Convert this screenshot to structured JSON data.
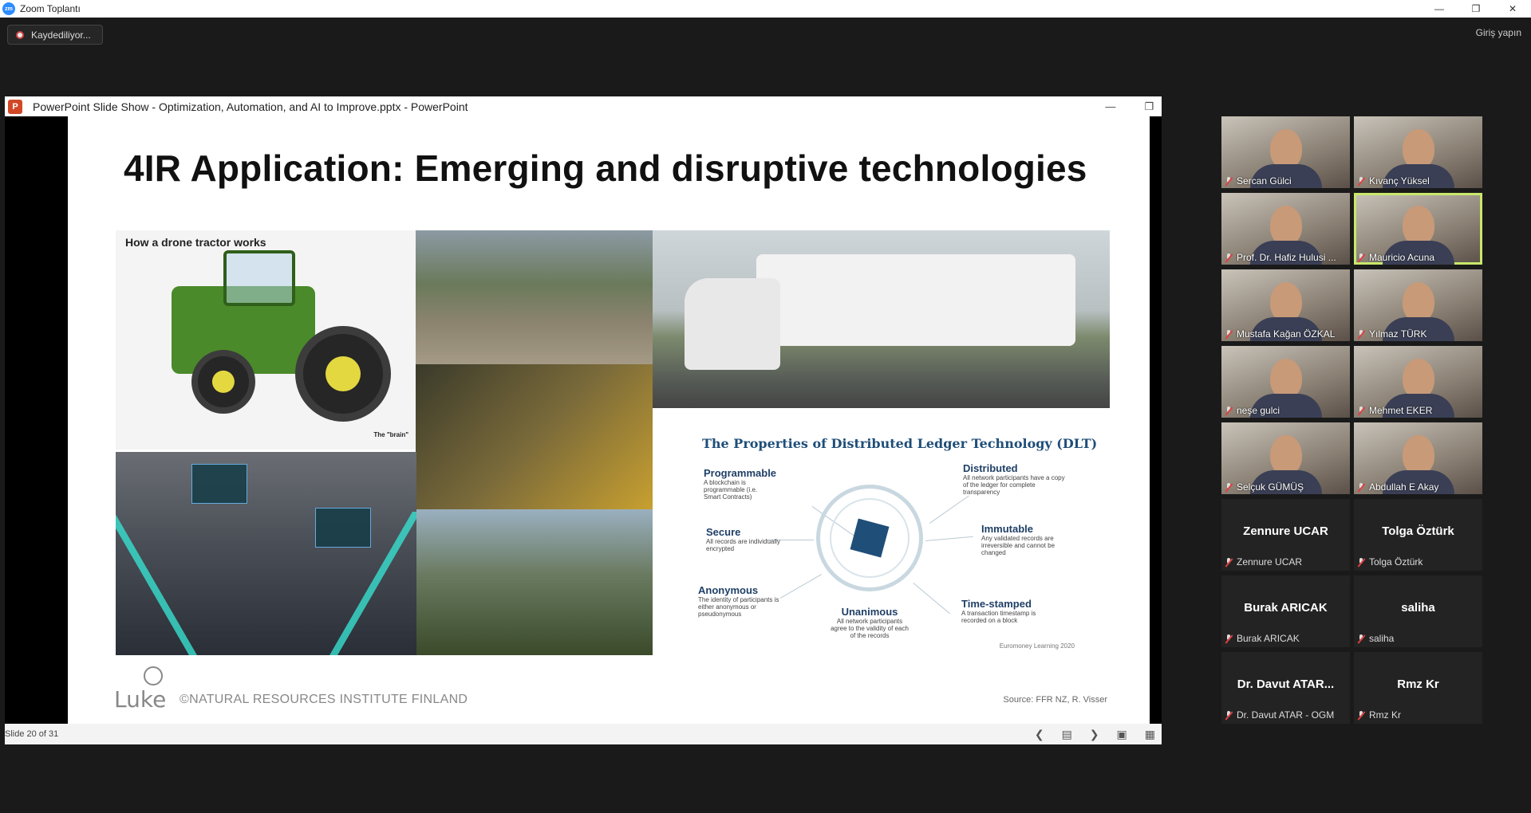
{
  "zoom": {
    "window_title": "Zoom Toplantı",
    "recording_label": "Kaydediliyor...",
    "signin_label": "Giriş yapın"
  },
  "ppt": {
    "window_title": "PowerPoint Slide Show  -  Optimization, Automation, and AI to Improve.pptx  -  PowerPoint",
    "slide_counter": "Slide 20 of 31"
  },
  "slide": {
    "title": "4IR Application: Emerging and disruptive technologies",
    "tractor_heading": "How a drone tractor works",
    "tractor_brain": "The \"brain\"",
    "dlt_title": "The Properties of Distributed Ledger Technology (DLT)",
    "dlt_items": [
      {
        "heading": "Programmable",
        "desc": "A blockchain is programmable (i.e. Smart Contracts)"
      },
      {
        "heading": "Distributed",
        "desc": "All network participants have a copy of the ledger for complete transparency"
      },
      {
        "heading": "Secure",
        "desc": "All records are individually encrypted"
      },
      {
        "heading": "Immutable",
        "desc": "Any validated records are irreversible and cannot be changed"
      },
      {
        "heading": "Anonymous",
        "desc": "The identity of participants is either anonymous or pseudonymous"
      },
      {
        "heading": "Unanimous",
        "desc": "All network participants agree to the validity of each of the records"
      },
      {
        "heading": "Time-stamped",
        "desc": "A transaction timestamp is recorded on a block"
      }
    ],
    "dlt_credit": "Euromoney Learning 2020",
    "logo_text": "Luke",
    "institute": "©NATURAL RESOURCES INSTITUTE FINLAND",
    "source": "Source: FFR NZ, R. Visser"
  },
  "participants": [
    {
      "name": "Sercan Gülci",
      "video": true
    },
    {
      "name": "Kıvanç Yüksel",
      "video": true
    },
    {
      "name": "Prof. Dr. Hafiz Hulusi ...",
      "video": true
    },
    {
      "name": "Mauricio Acuna",
      "video": true,
      "active": true
    },
    {
      "name": "Mustafa Kağan ÖZKAL",
      "video": true
    },
    {
      "name": "Yılmaz TÜRK",
      "video": true
    },
    {
      "name": "neşe gulci",
      "video": true
    },
    {
      "name": "Mehmet EKER",
      "video": true
    },
    {
      "name": "Selçuk GÜMÜŞ",
      "video": true
    },
    {
      "name": "Abdullah E Akay",
      "video": true
    },
    {
      "name": "Zennure UCAR",
      "display": "Zennure UCAR",
      "video": false
    },
    {
      "name": "Tolga Öztürk",
      "display": "Tolga Öztürk",
      "video": false
    },
    {
      "name": "Burak ARICAK",
      "display": "Burak ARICAK",
      "video": false
    },
    {
      "name": "saliha",
      "display": "saliha",
      "video": false
    },
    {
      "name": "Dr. Davut ATAR - OGM",
      "display": "Dr. Davut ATAR...",
      "video": false
    },
    {
      "name": "Rmz Kr",
      "display": "Rmz Kr",
      "video": false
    }
  ]
}
